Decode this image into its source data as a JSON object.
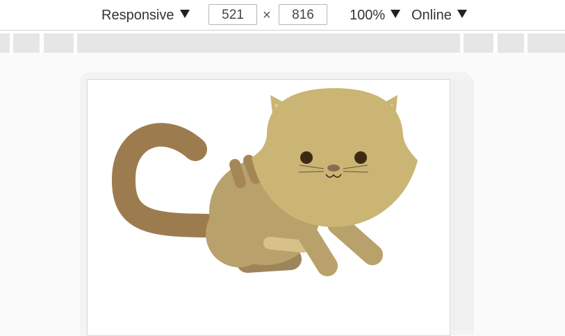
{
  "toolbar": {
    "device_label": "Responsive",
    "width_value": "521",
    "times_symbol": "×",
    "height_value": "816",
    "zoom_label": "100%",
    "throttle_label": "Online"
  },
  "icons": {
    "device_dropdown": "triangle-down-icon",
    "zoom_dropdown": "triangle-down-icon",
    "throttle_dropdown": "triangle-down-icon"
  },
  "colors": {
    "cat_head": "#cbb574",
    "cat_body": "#b9a16b",
    "cat_tail": "#9c7c4f",
    "cat_stripe": "#a58657",
    "cat_back_leg": "#9d8559",
    "cat_ear_inner": "#e6d4a2"
  }
}
